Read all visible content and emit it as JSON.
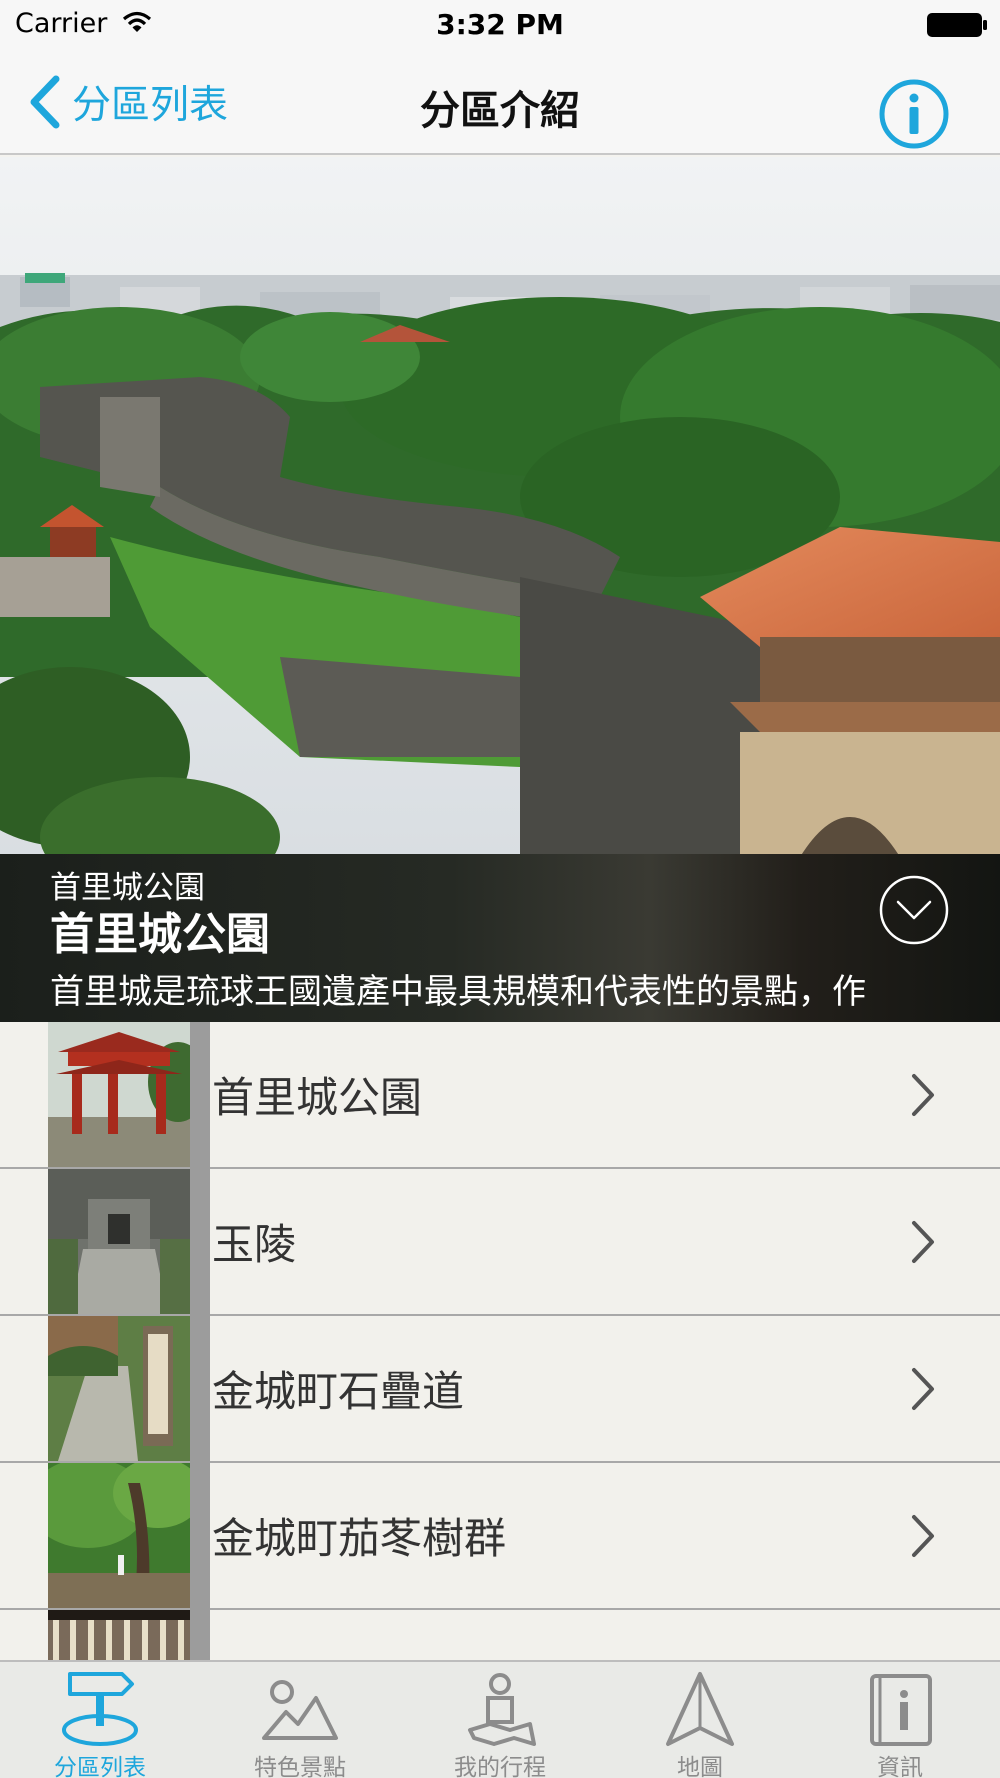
{
  "status_bar": {
    "carrier": "Carrier",
    "time": "3:32 PM",
    "icons": [
      "wifi-icon",
      "battery-icon"
    ]
  },
  "nav": {
    "back_label": "分區列表",
    "title": "分區介紹",
    "back_icon": "chevron-left-icon",
    "info_icon": "info-circle-icon",
    "accent_color": "#1ea6dc"
  },
  "hero": {
    "image": "shuri-castle-photo",
    "subtitle": "首里城公園",
    "title": "首里城公園",
    "description": "首里城是琉球王國遺產中最具規模和代表性的景點，作",
    "expand_icon": "chevron-down-circle-icon"
  },
  "list": {
    "items": [
      {
        "label": "首里城公園",
        "thumb": "red-gate-photo"
      },
      {
        "label": "玉陵",
        "thumb": "stone-tomb-photo"
      },
      {
        "label": "金城町石疊道",
        "thumb": "stone-path-photo"
      },
      {
        "label": "金城町茄苳樹群",
        "thumb": "banyan-trees-photo"
      },
      {
        "label": "",
        "thumb": "partial-photo"
      }
    ],
    "row_icon": "chevron-right-icon"
  },
  "tab_bar": {
    "tabs": [
      {
        "label": "分區列表",
        "icon": "signpost-icon",
        "active": true
      },
      {
        "label": "特色景點",
        "icon": "mountain-icon",
        "active": false
      },
      {
        "label": "我的行程",
        "icon": "person-map-icon",
        "active": false
      },
      {
        "label": "地圖",
        "icon": "compass-arrow-icon",
        "active": false
      },
      {
        "label": "資訊",
        "icon": "info-book-icon",
        "active": false
      }
    ],
    "active_color": "#1ea6dc",
    "inactive_color": "#8c8c8c"
  }
}
